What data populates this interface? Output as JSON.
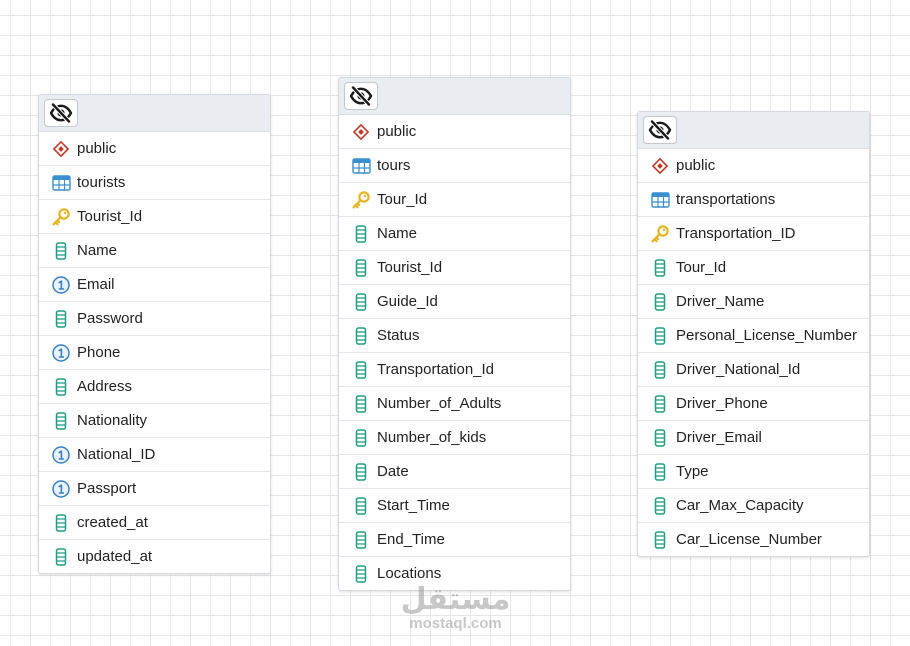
{
  "tables": [
    {
      "id": "tourists",
      "rows": [
        {
          "type": "schema",
          "icon": "schema-icon",
          "label": "public"
        },
        {
          "type": "table",
          "icon": "table-icon",
          "label": "tourists"
        },
        {
          "type": "pk",
          "icon": "primary-key-icon",
          "label": "Tourist_Id"
        },
        {
          "type": "column",
          "icon": "column-icon",
          "label": "Name"
        },
        {
          "type": "unique",
          "icon": "unique-column-icon",
          "label": "Email"
        },
        {
          "type": "column",
          "icon": "column-icon",
          "label": "Password"
        },
        {
          "type": "unique",
          "icon": "unique-column-icon",
          "label": "Phone"
        },
        {
          "type": "column",
          "icon": "column-icon",
          "label": "Address"
        },
        {
          "type": "column",
          "icon": "column-icon",
          "label": "Nationality"
        },
        {
          "type": "unique",
          "icon": "unique-column-icon",
          "label": "National_ID"
        },
        {
          "type": "unique",
          "icon": "unique-column-icon",
          "label": "Passport"
        },
        {
          "type": "column",
          "icon": "column-icon",
          "label": "created_at"
        },
        {
          "type": "column",
          "icon": "column-icon",
          "label": "updated_at"
        }
      ]
    },
    {
      "id": "tours",
      "rows": [
        {
          "type": "schema",
          "icon": "schema-icon",
          "label": "public"
        },
        {
          "type": "table",
          "icon": "table-icon",
          "label": "tours"
        },
        {
          "type": "pk",
          "icon": "primary-key-icon",
          "label": "Tour_Id"
        },
        {
          "type": "column",
          "icon": "column-icon",
          "label": "Name"
        },
        {
          "type": "column",
          "icon": "column-icon",
          "label": "Tourist_Id"
        },
        {
          "type": "column",
          "icon": "column-icon",
          "label": "Guide_Id"
        },
        {
          "type": "column",
          "icon": "column-icon",
          "label": "Status"
        },
        {
          "type": "column",
          "icon": "column-icon",
          "label": "Transportation_Id"
        },
        {
          "type": "column",
          "icon": "column-icon",
          "label": "Number_of_Adults"
        },
        {
          "type": "column",
          "icon": "column-icon",
          "label": "Number_of_kids"
        },
        {
          "type": "column",
          "icon": "column-icon",
          "label": "Date"
        },
        {
          "type": "column",
          "icon": "column-icon",
          "label": "Start_Time"
        },
        {
          "type": "column",
          "icon": "column-icon",
          "label": "End_Time"
        },
        {
          "type": "column",
          "icon": "column-icon",
          "label": "Locations"
        }
      ]
    },
    {
      "id": "transportations",
      "rows": [
        {
          "type": "schema",
          "icon": "schema-icon",
          "label": "public"
        },
        {
          "type": "table",
          "icon": "table-icon",
          "label": "transportations"
        },
        {
          "type": "pk",
          "icon": "primary-key-icon",
          "label": "Transportation_ID"
        },
        {
          "type": "column",
          "icon": "column-icon",
          "label": "Tour_Id"
        },
        {
          "type": "column",
          "icon": "column-icon",
          "label": "Driver_Name"
        },
        {
          "type": "column",
          "icon": "column-icon",
          "label": "Personal_License_Number"
        },
        {
          "type": "column",
          "icon": "column-icon",
          "label": "Driver_National_Id"
        },
        {
          "type": "column",
          "icon": "column-icon",
          "label": "Driver_Phone"
        },
        {
          "type": "column",
          "icon": "column-icon",
          "label": "Driver_Email"
        },
        {
          "type": "column",
          "icon": "column-icon",
          "label": "Type"
        },
        {
          "type": "column",
          "icon": "column-icon",
          "label": "Car_Max_Capacity"
        },
        {
          "type": "column",
          "icon": "column-icon",
          "label": "Car_License_Number"
        }
      ]
    }
  ],
  "header_icon": "eye-slash-icon",
  "colors": {
    "schema": "#c0392b",
    "table": "#3a8fd0",
    "key": "#e6b422",
    "column": "#1f9e84",
    "unique": "#3a7fc4"
  },
  "watermark": {
    "arabic": "مستقل",
    "latin": "mostaql.com"
  }
}
